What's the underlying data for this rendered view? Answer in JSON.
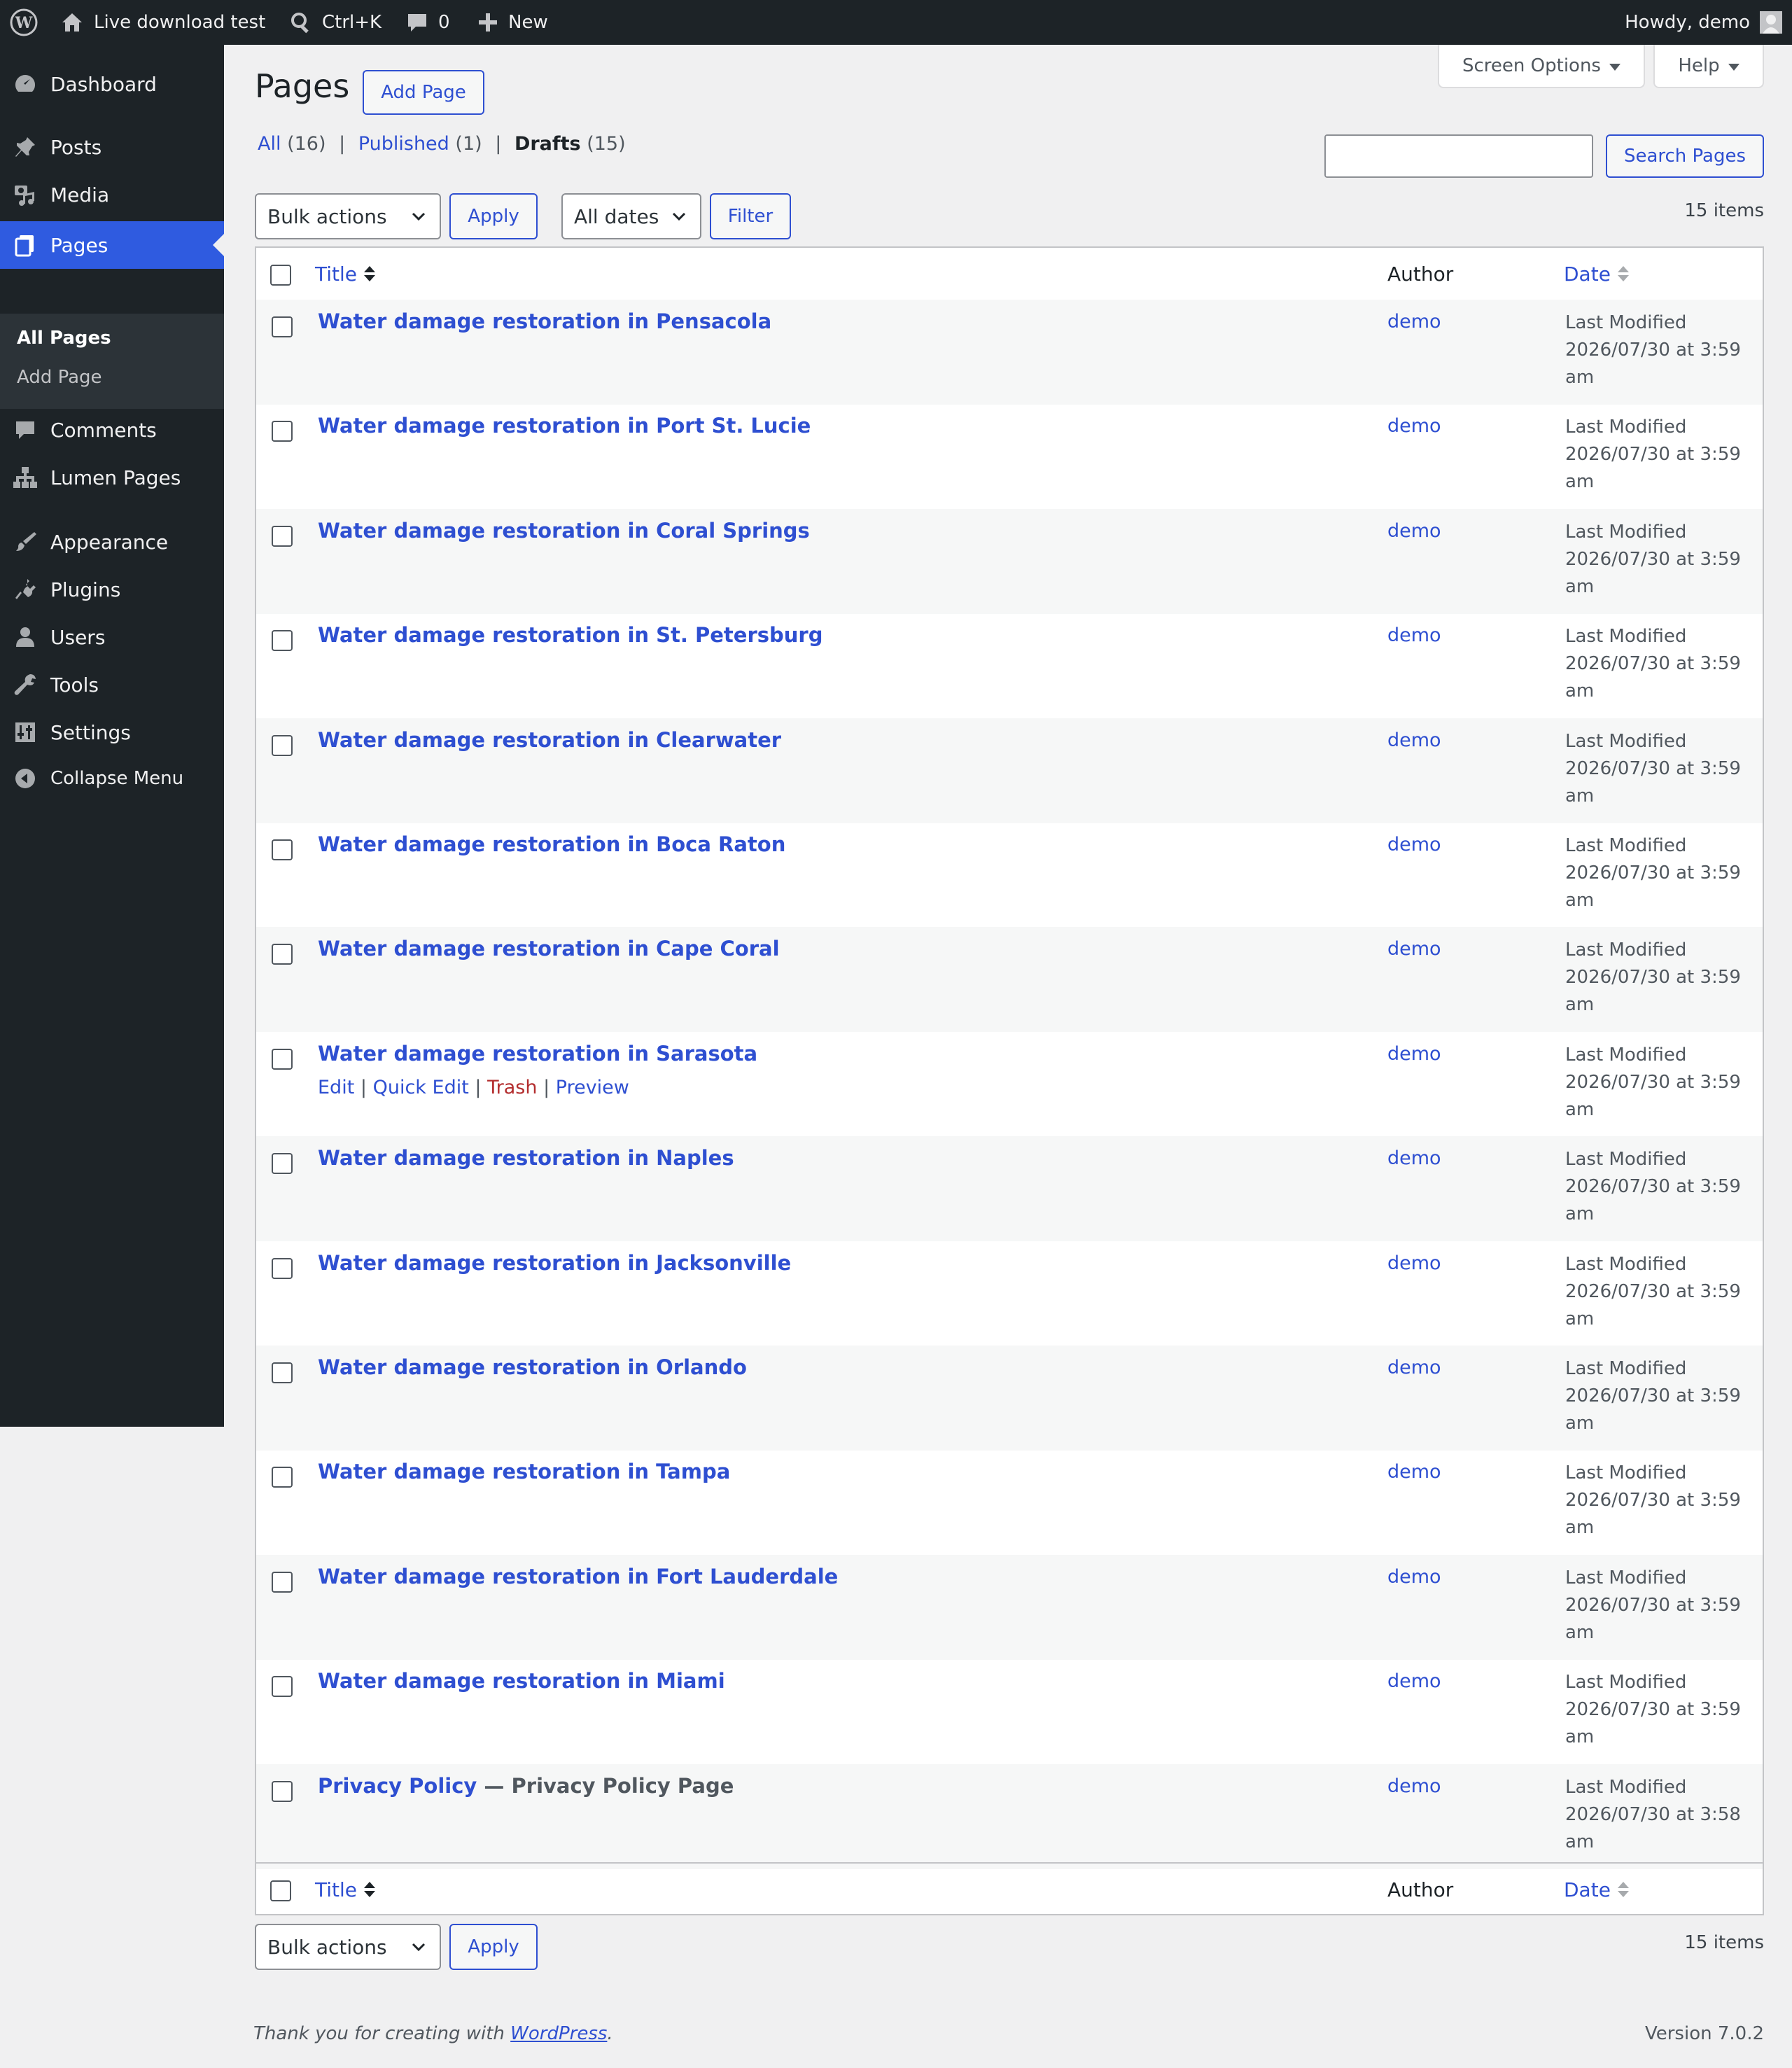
{
  "admin_bar": {
    "site_name": "Live download test",
    "search_shortcut": "Ctrl+K",
    "comments_count": "0",
    "new_label": "New",
    "howdy": "Howdy, demo"
  },
  "sidebar": {
    "dashboard": "Dashboard",
    "posts": "Posts",
    "media": "Media",
    "pages": "Pages",
    "all_pages": "All Pages",
    "add_page": "Add Page",
    "comments": "Comments",
    "lumen_pages": "Lumen Pages",
    "appearance": "Appearance",
    "plugins": "Plugins",
    "users": "Users",
    "tools": "Tools",
    "settings": "Settings",
    "collapse": "Collapse Menu"
  },
  "header": {
    "title": "Pages",
    "add_page_button": "Add Page",
    "screen_options": "Screen Options",
    "help": "Help"
  },
  "filters": {
    "all_label": "All",
    "all_count": "(16)",
    "published_label": "Published",
    "published_count": "(1)",
    "drafts_label": "Drafts",
    "drafts_count": "(15)",
    "sep": "|"
  },
  "search": {
    "value": "",
    "button": "Search Pages"
  },
  "tablenav_top": {
    "bulk_actions": "Bulk actions",
    "apply": "Apply",
    "dates": "All dates",
    "filter": "Filter",
    "items": "15 items"
  },
  "columns": {
    "title": "Title",
    "author": "Author",
    "date": "Date"
  },
  "row_actions": {
    "edit": "Edit",
    "quick_edit": "Quick Edit",
    "trash": "Trash",
    "preview": "Preview",
    "sep": "|"
  },
  "rows": [
    {
      "title": "Water damage restoration in Pensacola",
      "state": "",
      "author": "demo",
      "date_status": "Last Modified",
      "date_value": "2026/07/30 at 3:59",
      "date_ampm": "am"
    },
    {
      "title": "Water damage restoration in Port St. Lucie",
      "state": "",
      "author": "demo",
      "date_status": "Last Modified",
      "date_value": "2026/07/30 at 3:59",
      "date_ampm": "am"
    },
    {
      "title": "Water damage restoration in Coral Springs",
      "state": "",
      "author": "demo",
      "date_status": "Last Modified",
      "date_value": "2026/07/30 at 3:59",
      "date_ampm": "am"
    },
    {
      "title": "Water damage restoration in St. Petersburg",
      "state": "",
      "author": "demo",
      "date_status": "Last Modified",
      "date_value": "2026/07/30 at 3:59",
      "date_ampm": "am"
    },
    {
      "title": "Water damage restoration in Clearwater",
      "state": "",
      "author": "demo",
      "date_status": "Last Modified",
      "date_value": "2026/07/30 at 3:59",
      "date_ampm": "am"
    },
    {
      "title": "Water damage restoration in Boca Raton",
      "state": "",
      "author": "demo",
      "date_status": "Last Modified",
      "date_value": "2026/07/30 at 3:59",
      "date_ampm": "am"
    },
    {
      "title": "Water damage restoration in Cape Coral",
      "state": "",
      "author": "demo",
      "date_status": "Last Modified",
      "date_value": "2026/07/30 at 3:59",
      "date_ampm": "am"
    },
    {
      "title": "Water damage restoration in Sarasota",
      "state": "",
      "author": "demo",
      "date_status": "Last Modified",
      "date_value": "2026/07/30 at 3:59",
      "date_ampm": "am"
    },
    {
      "title": "Water damage restoration in Naples",
      "state": "",
      "author": "demo",
      "date_status": "Last Modified",
      "date_value": "2026/07/30 at 3:59",
      "date_ampm": "am"
    },
    {
      "title": "Water damage restoration in Jacksonville",
      "state": "",
      "author": "demo",
      "date_status": "Last Modified",
      "date_value": "2026/07/30 at 3:59",
      "date_ampm": "am"
    },
    {
      "title": "Water damage restoration in Orlando",
      "state": "",
      "author": "demo",
      "date_status": "Last Modified",
      "date_value": "2026/07/30 at 3:59",
      "date_ampm": "am"
    },
    {
      "title": "Water damage restoration in Tampa",
      "state": "",
      "author": "demo",
      "date_status": "Last Modified",
      "date_value": "2026/07/30 at 3:59",
      "date_ampm": "am"
    },
    {
      "title": "Water damage restoration in Fort Lauderdale",
      "state": "",
      "author": "demo",
      "date_status": "Last Modified",
      "date_value": "2026/07/30 at 3:59",
      "date_ampm": "am"
    },
    {
      "title": "Water damage restoration in Miami",
      "state": "",
      "author": "demo",
      "date_status": "Last Modified",
      "date_value": "2026/07/30 at 3:59",
      "date_ampm": "am"
    },
    {
      "title": "Privacy Policy",
      "state": " — Privacy Policy Page",
      "author": "demo",
      "date_status": "Last Modified",
      "date_value": "2026/07/30 at 3:58",
      "date_ampm": "am"
    }
  ],
  "tablenav_bottom": {
    "bulk_actions": "Bulk actions",
    "apply": "Apply",
    "items": "15 items"
  },
  "footer": {
    "thanks_prefix": "Thank you for creating with ",
    "wordpress_link": "WordPress",
    "thanks_suffix": ".",
    "version": "Version 7.0.2"
  }
}
